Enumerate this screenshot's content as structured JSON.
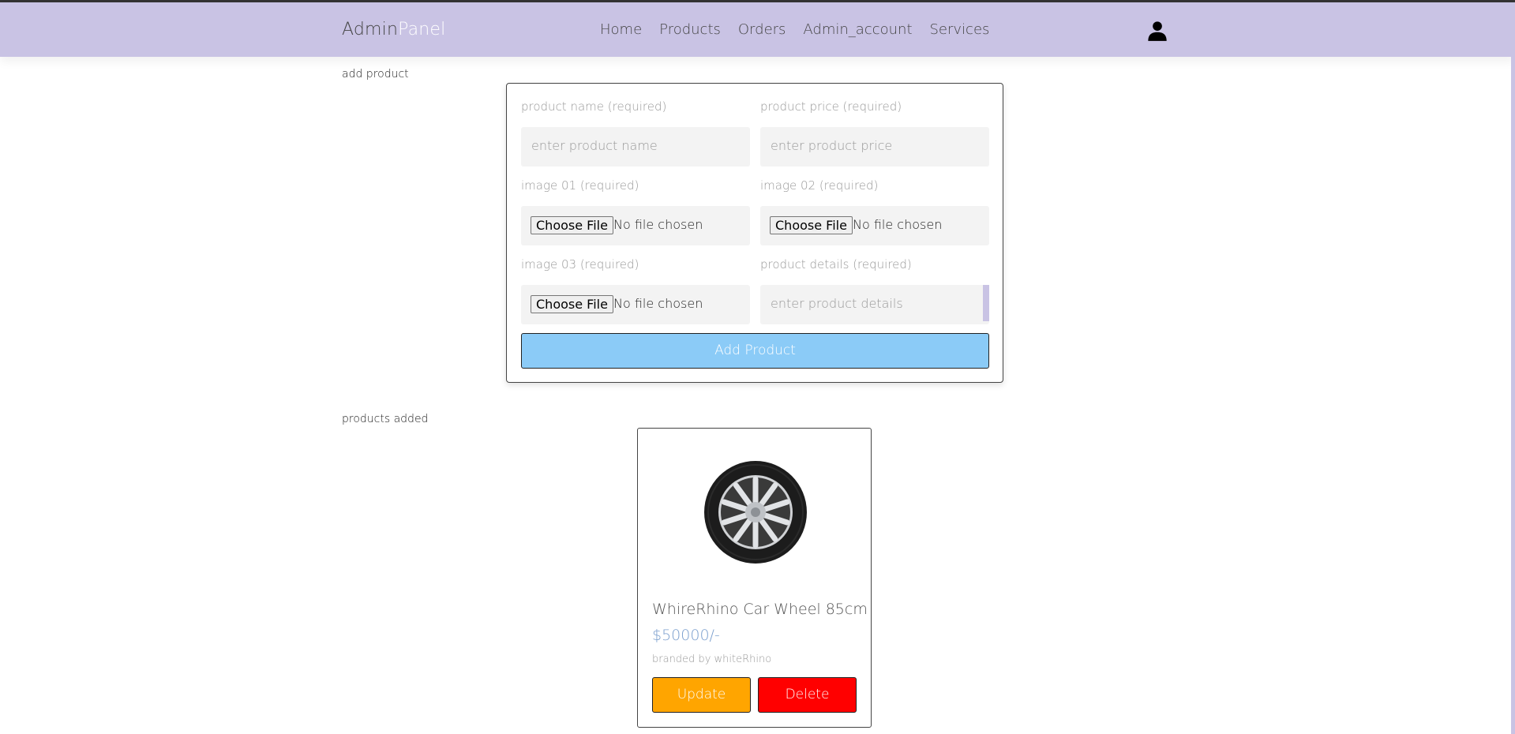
{
  "header": {
    "logo_main": "Admin",
    "logo_accent": "Panel",
    "nav": [
      "Home",
      "Products",
      "Orders",
      "Admin_account",
      "Services"
    ]
  },
  "add_section": {
    "title": "add product",
    "fields": {
      "name_label": "product name (required)",
      "name_placeholder": "enter product name",
      "price_label": "product price (required)",
      "price_placeholder": "enter product price",
      "image1_label": "image 01 (required)",
      "image2_label": "image 02 (required)",
      "image3_label": "image 03 (required)",
      "details_label": "product details (required)",
      "details_placeholder": "enter product details",
      "file_button": "Choose File",
      "file_status": "No file chosen"
    },
    "submit_label": "Add Product"
  },
  "products_section": {
    "title": "products added",
    "items": [
      {
        "name": "WhireRhino Car Wheel 85cm",
        "price": "$50000/-",
        "brand": "branded by whiteRhino",
        "update_label": "Update",
        "delete_label": "Delete"
      }
    ]
  },
  "colors": {
    "header_bg": "#c9c3e4",
    "add_button": "#8bcbf7",
    "update_button": "#ffa500",
    "delete_button": "#ff0000",
    "price_text": "#7b9fce"
  }
}
